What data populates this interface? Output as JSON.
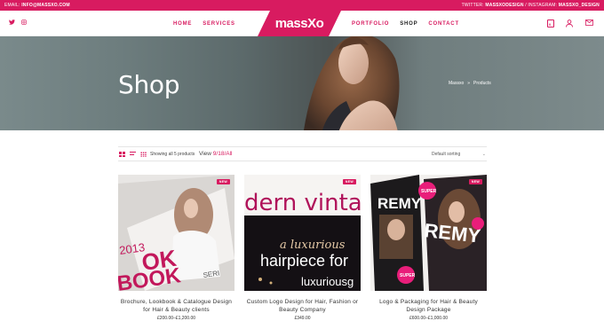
{
  "topbar": {
    "email_label": "EMAIL:",
    "email": "INFO@MASSXO.COM",
    "twitter_label": "TWITTER:",
    "twitter": "MASSXODESIGN",
    "separator": "/",
    "instagram_label": "INSTAGRAM:",
    "instagram": "MASSXO_DESIGN"
  },
  "social": [
    {
      "icon": "twitter-icon",
      "glyph": "🐦"
    },
    {
      "icon": "instagram-icon",
      "glyph": "◎"
    }
  ],
  "nav": {
    "left": [
      "HOME",
      "SERVICES"
    ],
    "right": [
      "PORTFOLIO",
      "SHOP",
      "CONTACT"
    ],
    "active": "SHOP"
  },
  "logo": {
    "text": "massXo"
  },
  "header_icons": {
    "cart_count": "0"
  },
  "hero": {
    "title": "Shop",
    "breadcrumb": [
      "Massxo",
      "»",
      "Products"
    ]
  },
  "toolbar": {
    "showing": "Showing all 5 products",
    "view_label": "View",
    "view_options": [
      "9",
      "18",
      "All"
    ],
    "view_separator": "/",
    "sorting": "Default sorting"
  },
  "products": [
    {
      "title": "Brochure, Lookbook & Catalogue Design for Hair & Beauty clients",
      "price": "£200.00–£1,200.00",
      "badge": "NEW",
      "image_text": [
        "2013",
        "OK",
        "BOOK",
        "SERI"
      ]
    },
    {
      "title": "Custom Logo Design for Hair, Fashion or Beauty Company",
      "price": "£349.00",
      "badge": "NEW",
      "image_text": [
        "dern vinta",
        "a luxurious",
        "hairpiece for",
        "luxuriousg"
      ]
    },
    {
      "title": "Logo & Packaging for Hair & Beauty Design Package",
      "price": "£600.00–£1,000.00",
      "badge": "NEW",
      "image_text": [
        "REMY",
        "REMY",
        "SUPER",
        "SUPER"
      ]
    }
  ],
  "colors": {
    "accent": "#d81b60",
    "hero": "#6d7d7e"
  }
}
